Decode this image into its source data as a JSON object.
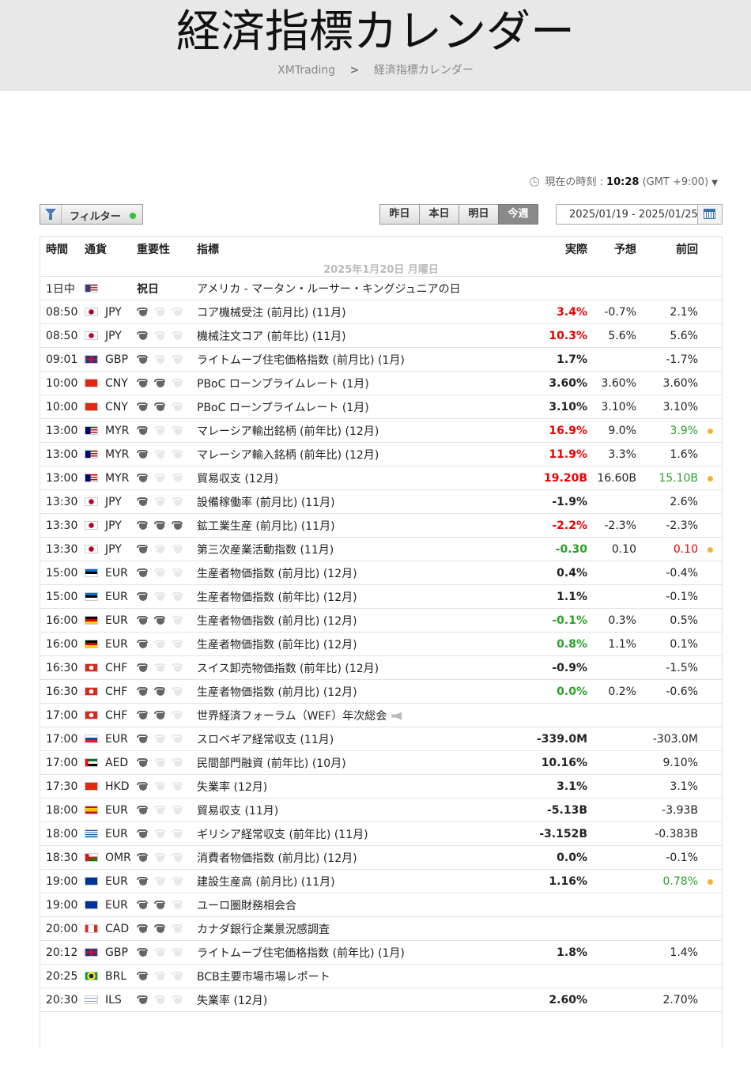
{
  "page": {
    "title": "経済指標カレンダー",
    "breadcrumb": [
      "XMTrading",
      "経済指標カレンダー"
    ]
  },
  "clock": {
    "label": "現在の時刻 :",
    "time": "10:28",
    "tz": "(GMT +9:00)"
  },
  "toolbar": {
    "filter_label": "フィルター",
    "day_tabs": [
      "昨日",
      "本日",
      "明日",
      "今週"
    ],
    "active_tab": "今週",
    "date_range": "2025/01/19 - 2025/01/25"
  },
  "table": {
    "headers": {
      "time": "時間",
      "currency": "通貨",
      "importance": "重要性",
      "indicator": "指標",
      "actual": "実際",
      "forecast": "予想",
      "previous": "前回"
    },
    "date_header": "2025年1月20日 月曜日",
    "colors": {
      "up": "#2aa12a",
      "down": "#ee0000",
      "neutral": "#222222",
      "dot": "#f0b33a"
    },
    "rows": [
      {
        "time": "1日中",
        "flag": "US",
        "cur": "",
        "imp": 0,
        "holiday": "祝日",
        "ind": "アメリカ - マータン・ルーサー・キングジュニアの日",
        "act": "",
        "actc": "",
        "fc": "",
        "prev": "",
        "prevc": "",
        "dot": false
      },
      {
        "time": "08:50",
        "flag": "JP",
        "cur": "JPY",
        "imp": 1,
        "ind": "コア機械受注 (前月比) (11月)",
        "act": "3.4%",
        "actc": "red",
        "fc": "-0.7%",
        "prev": "2.1%",
        "prevc": "",
        "dot": false
      },
      {
        "time": "08:50",
        "flag": "JP",
        "cur": "JPY",
        "imp": 1,
        "ind": "機械注文コア (前年比) (11月)",
        "act": "10.3%",
        "actc": "red",
        "fc": "5.6%",
        "prev": "5.6%",
        "prevc": "",
        "dot": false
      },
      {
        "time": "09:01",
        "flag": "GB",
        "cur": "GBP",
        "imp": 1,
        "ind": "ライトムーブ住宅価格指数 (前月比) (1月)",
        "act": "1.7%",
        "actc": "",
        "fc": "",
        "prev": "-1.7%",
        "prevc": "",
        "dot": false
      },
      {
        "time": "10:00",
        "flag": "CN",
        "cur": "CNY",
        "imp": 2,
        "ind": "PBoC ローンプライムレート (1月)",
        "act": "3.60%",
        "actc": "",
        "fc": "3.60%",
        "prev": "3.60%",
        "prevc": "",
        "dot": false
      },
      {
        "time": "10:00",
        "flag": "CN",
        "cur": "CNY",
        "imp": 2,
        "ind": "PBoC ローンプライムレート (1月)",
        "act": "3.10%",
        "actc": "",
        "fc": "3.10%",
        "prev": "3.10%",
        "prevc": "",
        "dot": false
      },
      {
        "time": "13:00",
        "flag": "MY",
        "cur": "MYR",
        "imp": 1,
        "ind": "マレーシア輸出銘柄 (前年比) (12月)",
        "act": "16.9%",
        "actc": "red",
        "fc": "9.0%",
        "prev": "3.9%",
        "prevc": "green",
        "dot": true
      },
      {
        "time": "13:00",
        "flag": "MY",
        "cur": "MYR",
        "imp": 1,
        "ind": "マレーシア輸入銘柄 (前年比) (12月)",
        "act": "11.9%",
        "actc": "red",
        "fc": "3.3%",
        "prev": "1.6%",
        "prevc": "",
        "dot": false
      },
      {
        "time": "13:00",
        "flag": "MY",
        "cur": "MYR",
        "imp": 1,
        "ind": "貿易収支 (12月)",
        "act": "19.20B",
        "actc": "red",
        "fc": "16.60B",
        "prev": "15.10B",
        "prevc": "green",
        "dot": true
      },
      {
        "time": "13:30",
        "flag": "JP",
        "cur": "JPY",
        "imp": 1,
        "ind": "設備稼働率 (前月比) (11月)",
        "act": "-1.9%",
        "actc": "",
        "fc": "",
        "prev": "2.6%",
        "prevc": "",
        "dot": false
      },
      {
        "time": "13:30",
        "flag": "JP",
        "cur": "JPY",
        "imp": 3,
        "ind": "鉱工業生産 (前月比) (11月)",
        "act": "-2.2%",
        "actc": "red",
        "fc": "-2.3%",
        "prev": "-2.3%",
        "prevc": "",
        "dot": false
      },
      {
        "time": "13:30",
        "flag": "JP",
        "cur": "JPY",
        "imp": 1,
        "ind": "第三次産業活動指数 (11月)",
        "act": "-0.30",
        "actc": "green",
        "fc": "0.10",
        "prev": "0.10",
        "prevc": "red",
        "dot": true
      },
      {
        "time": "15:00",
        "flag": "EE",
        "cur": "EUR",
        "imp": 1,
        "ind": "生産者物価指数 (前月比) (12月)",
        "act": "0.4%",
        "actc": "",
        "fc": "",
        "prev": "-0.4%",
        "prevc": "",
        "dot": false
      },
      {
        "time": "15:00",
        "flag": "EE",
        "cur": "EUR",
        "imp": 1,
        "ind": "生産者物価指数 (前年比) (12月)",
        "act": "1.1%",
        "actc": "",
        "fc": "",
        "prev": "-0.1%",
        "prevc": "",
        "dot": false
      },
      {
        "time": "16:00",
        "flag": "DE",
        "cur": "EUR",
        "imp": 2,
        "ind": "生産者物価指数 (前月比) (12月)",
        "act": "-0.1%",
        "actc": "green",
        "fc": "0.3%",
        "prev": "0.5%",
        "prevc": "",
        "dot": false
      },
      {
        "time": "16:00",
        "flag": "DE",
        "cur": "EUR",
        "imp": 1,
        "ind": "生産者物価指数 (前年比) (12月)",
        "act": "0.8%",
        "actc": "green",
        "fc": "1.1%",
        "prev": "0.1%",
        "prevc": "",
        "dot": false
      },
      {
        "time": "16:30",
        "flag": "CH",
        "cur": "CHF",
        "imp": 1,
        "ind": "スイス卸売物価指数 (前年比) (12月)",
        "act": "-0.9%",
        "actc": "",
        "fc": "",
        "prev": "-1.5%",
        "prevc": "",
        "dot": false
      },
      {
        "time": "16:30",
        "flag": "CH",
        "cur": "CHF",
        "imp": 2,
        "ind": "生産者物価指数 (前月比) (12月)",
        "act": "0.0%",
        "actc": "green",
        "fc": "0.2%",
        "prev": "-0.6%",
        "prevc": "",
        "dot": false
      },
      {
        "time": "17:00",
        "flag": "CH",
        "cur": "CHF",
        "imp": 2,
        "ind": "世界経済フォーラム（WEF）年次総会",
        "speech": true,
        "act": "",
        "actc": "",
        "fc": "",
        "prev": "",
        "prevc": "",
        "dot": false
      },
      {
        "time": "17:00",
        "flag": "SK",
        "cur": "EUR",
        "imp": 1,
        "ind": "スロベギア経常収支 (11月)",
        "act": "-339.0M",
        "actc": "",
        "fc": "",
        "prev": "-303.0M",
        "prevc": "",
        "dot": false
      },
      {
        "time": "17:00",
        "flag": "AE",
        "cur": "AED",
        "imp": 1,
        "ind": "民間部門融資 (前年比) (10月)",
        "act": "10.16%",
        "actc": "",
        "fc": "",
        "prev": "9.10%",
        "prevc": "",
        "dot": false
      },
      {
        "time": "17:30",
        "flag": "HK",
        "cur": "HKD",
        "imp": 1,
        "ind": "失業率 (12月)",
        "act": "3.1%",
        "actc": "",
        "fc": "",
        "prev": "3.1%",
        "prevc": "",
        "dot": false
      },
      {
        "time": "18:00",
        "flag": "ES",
        "cur": "EUR",
        "imp": 1,
        "ind": "貿易収支 (11月)",
        "act": "-5.13B",
        "actc": "",
        "fc": "",
        "prev": "-3.93B",
        "prevc": "",
        "dot": false
      },
      {
        "time": "18:00",
        "flag": "GR",
        "cur": "EUR",
        "imp": 1,
        "ind": "ギリシア経常収支 (前年比) (11月)",
        "act": "-3.152B",
        "actc": "",
        "fc": "",
        "prev": "-0.383B",
        "prevc": "",
        "dot": false
      },
      {
        "time": "18:30",
        "flag": "OM",
        "cur": "OMR",
        "imp": 1,
        "ind": "消費者物価指数 (前月比) (12月)",
        "act": "0.0%",
        "actc": "",
        "fc": "",
        "prev": "-0.1%",
        "prevc": "",
        "dot": false
      },
      {
        "time": "19:00",
        "flag": "EU",
        "cur": "EUR",
        "imp": 1,
        "ind": "建設生産高 (前月比) (11月)",
        "act": "1.16%",
        "actc": "",
        "fc": "",
        "prev": "0.78%",
        "prevc": "green",
        "dot": true
      },
      {
        "time": "19:00",
        "flag": "EU",
        "cur": "EUR",
        "imp": 2,
        "ind": "ユーロ圏財務相会合",
        "act": "",
        "actc": "",
        "fc": "",
        "prev": "",
        "prevc": "",
        "dot": false
      },
      {
        "time": "20:00",
        "flag": "CA",
        "cur": "CAD",
        "imp": 2,
        "ind": "カナダ銀行企業景況感調査",
        "act": "",
        "actc": "",
        "fc": "",
        "prev": "",
        "prevc": "",
        "dot": false
      },
      {
        "time": "20:12",
        "flag": "GB",
        "cur": "GBP",
        "imp": 1,
        "ind": "ライトムーブ住宅価格指数 (前年比) (1月)",
        "act": "1.8%",
        "actc": "",
        "fc": "",
        "prev": "1.4%",
        "prevc": "",
        "dot": false
      },
      {
        "time": "20:25",
        "flag": "BR",
        "cur": "BRL",
        "imp": 1,
        "ind": "BCB主要市場市場レポート",
        "act": "",
        "actc": "",
        "fc": "",
        "prev": "",
        "prevc": "",
        "dot": false
      },
      {
        "time": "20:30",
        "flag": "IL",
        "cur": "ILS",
        "imp": 1,
        "ind": "失業率 (12月)",
        "act": "2.60%",
        "actc": "",
        "fc": "",
        "prev": "2.70%",
        "prevc": "",
        "dot": false
      }
    ]
  },
  "flag_colors": {
    "US": "#b22234",
    "JP": "#ffffff",
    "GB": "#1f3a8a",
    "CN": "#de2910",
    "MY": "#cc0001",
    "EE": "#0072ce",
    "DE": "#000000",
    "CH": "#d52b1e",
    "SK": "#0b4ea2",
    "AE": "#00732f",
    "HK": "#de2910",
    "ES": "#c60b1e",
    "GR": "#0d5eaf",
    "OM": "#db161b",
    "EU": "#003399",
    "CA": "#d52b1e",
    "BR": "#009c3b",
    "IL": "#ffffff"
  }
}
